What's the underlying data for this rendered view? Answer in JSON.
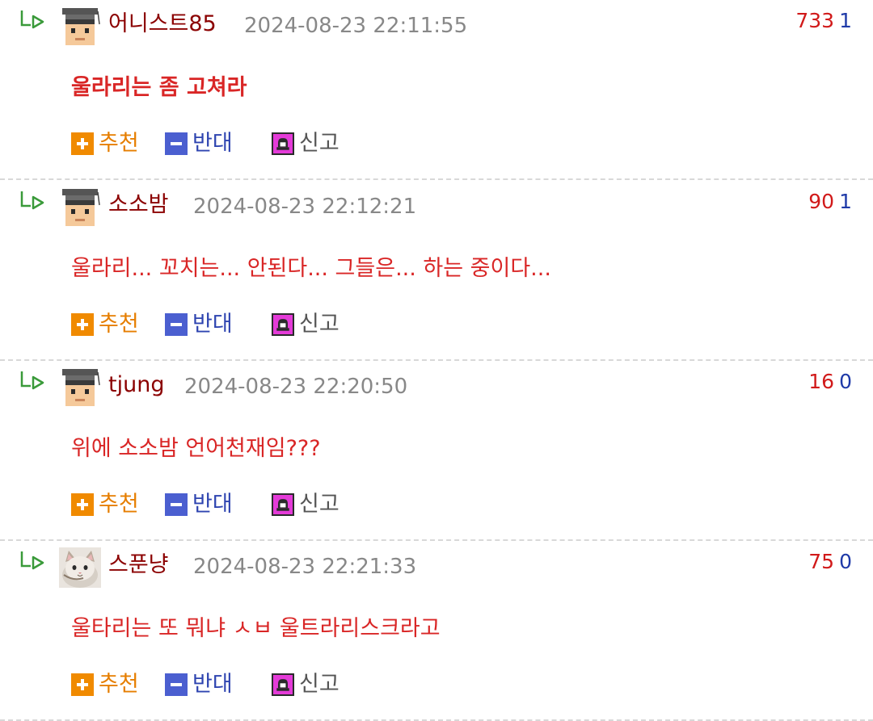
{
  "comments": [
    {
      "author": "어니스트85",
      "timestamp": "2024-08-23 22:11:55",
      "up": "733",
      "down": "1",
      "body": "울라리는 좀 고쳐라",
      "avatar": "graduate-avatar"
    },
    {
      "author": "소소밤",
      "timestamp": "2024-08-23 22:12:21",
      "up": "90",
      "down": "1",
      "body": "울라리... 꼬치는... 안된다... 그들은... 하는 중이다...",
      "avatar": "graduate-avatar"
    },
    {
      "author": "tjung",
      "timestamp": "2024-08-23 22:20:50",
      "up": "16",
      "down": "0",
      "body": "위에 소소밤 언어천재임???",
      "avatar": "graduate-avatar"
    },
    {
      "author": "스푼냥",
      "timestamp": "2024-08-23 22:21:33",
      "up": "75",
      "down": "0",
      "body": "울타리는 또 뭐냐 ㅅㅂ 울트라리스크라고",
      "avatar": "cat-photo-avatar"
    }
  ],
  "actions": {
    "recommend": "추천",
    "oppose": "반대",
    "report": "신고"
  },
  "icons": {
    "reply": "reply-arrow-icon",
    "recommend": "plus-icon",
    "oppose": "minus-icon",
    "report": "siren-icon"
  },
  "colors": {
    "author": "#8b0000",
    "body": "#d92626",
    "upvote": "#d11a1a",
    "downvote": "#1f3aa8",
    "recommend": "#e67e00",
    "oppose": "#2e44b0"
  }
}
